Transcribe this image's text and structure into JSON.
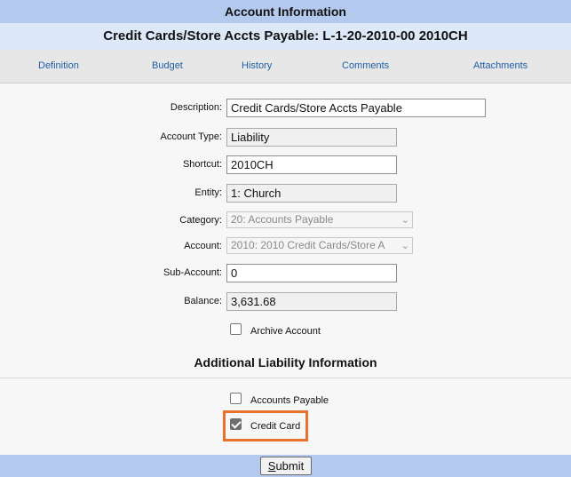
{
  "header": {
    "title": "Account Information",
    "subtitle": "Credit Cards/Store Accts Payable: L-1-20-2010-00 2010CH"
  },
  "tabs": [
    {
      "label": "Definition"
    },
    {
      "label": "Budget"
    },
    {
      "label": "History"
    },
    {
      "label": "Comments"
    },
    {
      "label": "Attachments"
    }
  ],
  "form": {
    "description": {
      "label": "Description:",
      "value": "Credit Cards/Store Accts Payable"
    },
    "account_type": {
      "label": "Account Type:",
      "value": "Liability"
    },
    "shortcut": {
      "label": "Shortcut:",
      "value": "2010CH"
    },
    "entity": {
      "label": "Entity:",
      "value": "1: Church"
    },
    "category": {
      "label": "Category:",
      "value": "20: Accounts Payable"
    },
    "account": {
      "label": "Account:",
      "value": "2010: 2010 Credit Cards/Store A"
    },
    "sub_account": {
      "label": "Sub-Account:",
      "value": "0"
    },
    "balance": {
      "label": "Balance:",
      "value": "3,631.68"
    },
    "archive": {
      "label": "Archive Account",
      "checked": false
    }
  },
  "additional": {
    "title": "Additional Liability Information",
    "accounts_payable": {
      "label": "Accounts Payable",
      "checked": false
    },
    "credit_card": {
      "label": "Credit Card",
      "checked": true
    }
  },
  "footer": {
    "submit_first": "S",
    "submit_rest": "ubmit"
  },
  "colors": {
    "header_bg": "#b4c9ee",
    "subheader_bg": "#dde8f8",
    "tab_link": "#1f5fa8",
    "highlight": "#e8702a"
  },
  "icons": {
    "select_chevron": "chevron-down-icon"
  }
}
